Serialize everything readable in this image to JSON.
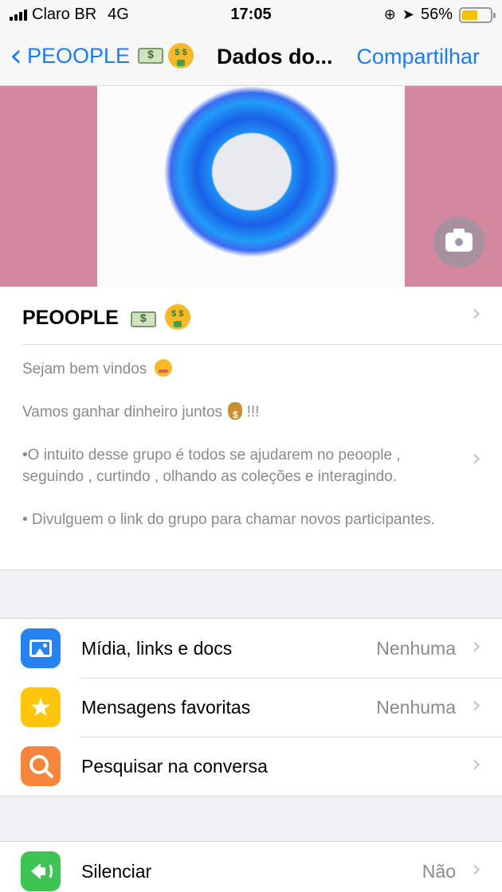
{
  "status_bar": {
    "carrier": "Claro BR",
    "network": "4G",
    "time": "17:05",
    "battery_percent": "56%",
    "battery_level": 0.56,
    "icons": [
      "signal-icon",
      "screen-rotation-lock-icon",
      "location-arrow-icon",
      "battery-icon"
    ]
  },
  "nav": {
    "back_label": "PEOOPLE",
    "back_emojis": [
      "dollar-banknote-emoji",
      "money-mouth-face-emoji"
    ],
    "title": "Dados do...",
    "share_label": "Compartilhar"
  },
  "hero": {
    "background_color": "#d4889f",
    "image": "blue-ring-logo",
    "camera_icon": "camera-icon"
  },
  "group": {
    "name": "PEOOPLE",
    "name_emojis": [
      "dollar-banknote-emoji",
      "money-mouth-face-emoji"
    ],
    "description": {
      "line1": "Sejam bem vindos",
      "line1_emoji": "smiling-face-with-hearts-emoji",
      "line2_before": "Vamos ganhar dinheiro juntos",
      "line2_emoji": "money-bag-emoji",
      "line2_after": " !!!",
      "line3": "•O intuito desse grupo é todos se ajudarem no peoople , seguindo , curtindo , olhando as coleções e interagindo.",
      "line4": "• Divulguem o link do grupo para chamar novos participantes."
    }
  },
  "menu": {
    "media": {
      "label": "Mídia, links e docs",
      "value": "Nenhuma",
      "icon": "photo-icon",
      "color": "#2584f2"
    },
    "starred": {
      "label": "Mensagens favoritas",
      "value": "Nenhuma",
      "icon": "star-icon",
      "color": "#ffc50a"
    },
    "search": {
      "label": "Pesquisar na conversa",
      "icon": "search-icon",
      "color": "#f7853b"
    },
    "mute": {
      "label": "Silenciar",
      "value": "Não",
      "icon": "speaker-icon",
      "color": "#3ec453"
    }
  },
  "chevron_glyph": "›",
  "back_glyph": "‹",
  "star_glyph": "★"
}
